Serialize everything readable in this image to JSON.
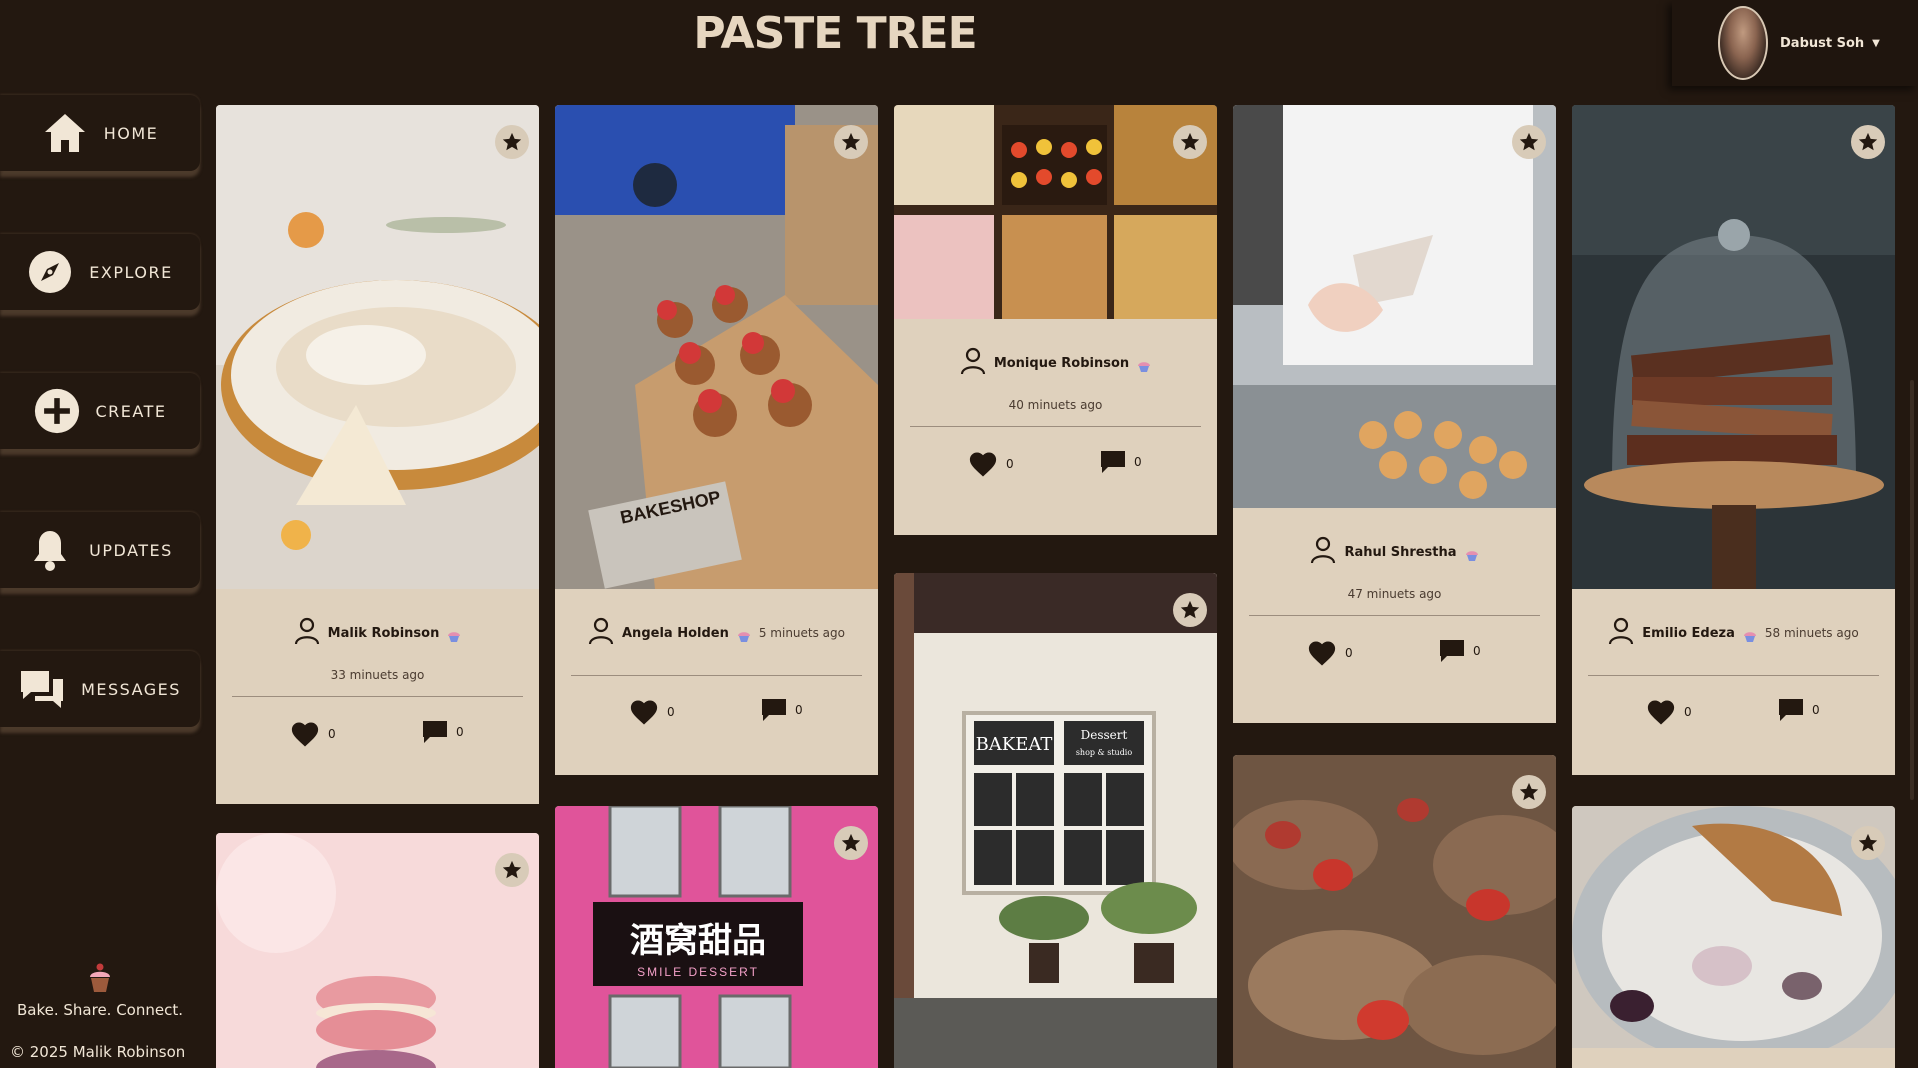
{
  "app": {
    "title": "PASTE TREE"
  },
  "user": {
    "name": "Dabust Soh"
  },
  "nav": [
    {
      "label": "HOME",
      "icon": "home-icon"
    },
    {
      "label": "EXPLORE",
      "icon": "compass-icon"
    },
    {
      "label": "CREATE",
      "icon": "plus-icon"
    },
    {
      "label": "UPDATES",
      "icon": "bell-icon"
    },
    {
      "label": "MESSAGES",
      "icon": "chat-icon"
    }
  ],
  "footer": {
    "tagline": "Bake. Share. Connect.",
    "copyright": "© 2025 Malik Robinson"
  },
  "posts": [
    {
      "author": "Malik Robinson",
      "time": "33 minuets ago",
      "likes": "0",
      "comments": "0",
      "image": "lemon-meringue-pie"
    },
    {
      "author": "Angela Holden",
      "time": "5 minuets ago",
      "likes": "0",
      "comments": "0",
      "image": "strawberry-cupcakes-bakeshop"
    },
    {
      "author": "Monique Robinson",
      "time": "40 minuets ago",
      "likes": "0",
      "comments": "0",
      "image": "pastry-display"
    },
    {
      "author": "Rahul Shrestha",
      "time": "47 minuets ago",
      "likes": "0",
      "comments": "0",
      "image": "piping-choux"
    },
    {
      "author": "Emilio Edeza",
      "time": "58 minuets ago",
      "likes": "0",
      "comments": "0",
      "image": "cake-under-dome"
    },
    {
      "image": "pink-macaron"
    },
    {
      "image": "smile-dessert-storefront",
      "sign_cn": "酒窝甜品",
      "sign_en": "SMILE DESSERT"
    },
    {
      "image": "bakeat-storefront",
      "sign_left": "BAKEAT",
      "sign_right_1": "Dessert",
      "sign_right_2": "shop & studio"
    },
    {
      "image": "strawberry-cakes"
    },
    {
      "image": "eaten-pie"
    }
  ],
  "colors": {
    "background": "#231810",
    "card": "#dfd1bd",
    "text": "#f1e6d6"
  }
}
